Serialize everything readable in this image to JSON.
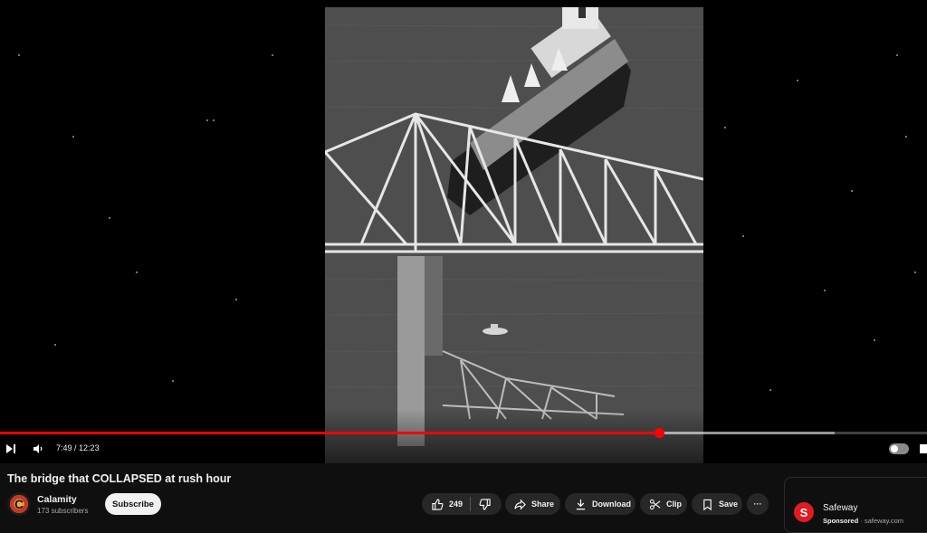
{
  "player": {
    "time_current": "7:49",
    "time_separator": " / ",
    "time_total": "12:23",
    "progress_played": 0.711,
    "progress_loaded": 0.9,
    "colors": {
      "played": "#ff0000",
      "scrubber": "#ff0000"
    }
  },
  "video": {
    "title": "The bridge that COLLAPSED at rush hour"
  },
  "channel": {
    "name": "Calamity",
    "subscribers": "173 subscribers",
    "subscribe_label": "Subscribe"
  },
  "actions": {
    "like_count": "249",
    "share_label": "Share",
    "download_label": "Download",
    "clip_label": "Clip",
    "save_label": "Save",
    "more_label": "···"
  },
  "ad": {
    "name": "Safeway",
    "sponsored": "Sponsored",
    "separator": " · ",
    "domain": "safeway.com",
    "brand_color": "#e11b22"
  },
  "icons": [
    "next-icon",
    "volume-icon",
    "autoplay-toggle",
    "like-icon",
    "dislike-icon",
    "share-icon",
    "download-icon",
    "clip-icon",
    "save-icon",
    "more-icon",
    "safeway-logo-icon"
  ]
}
